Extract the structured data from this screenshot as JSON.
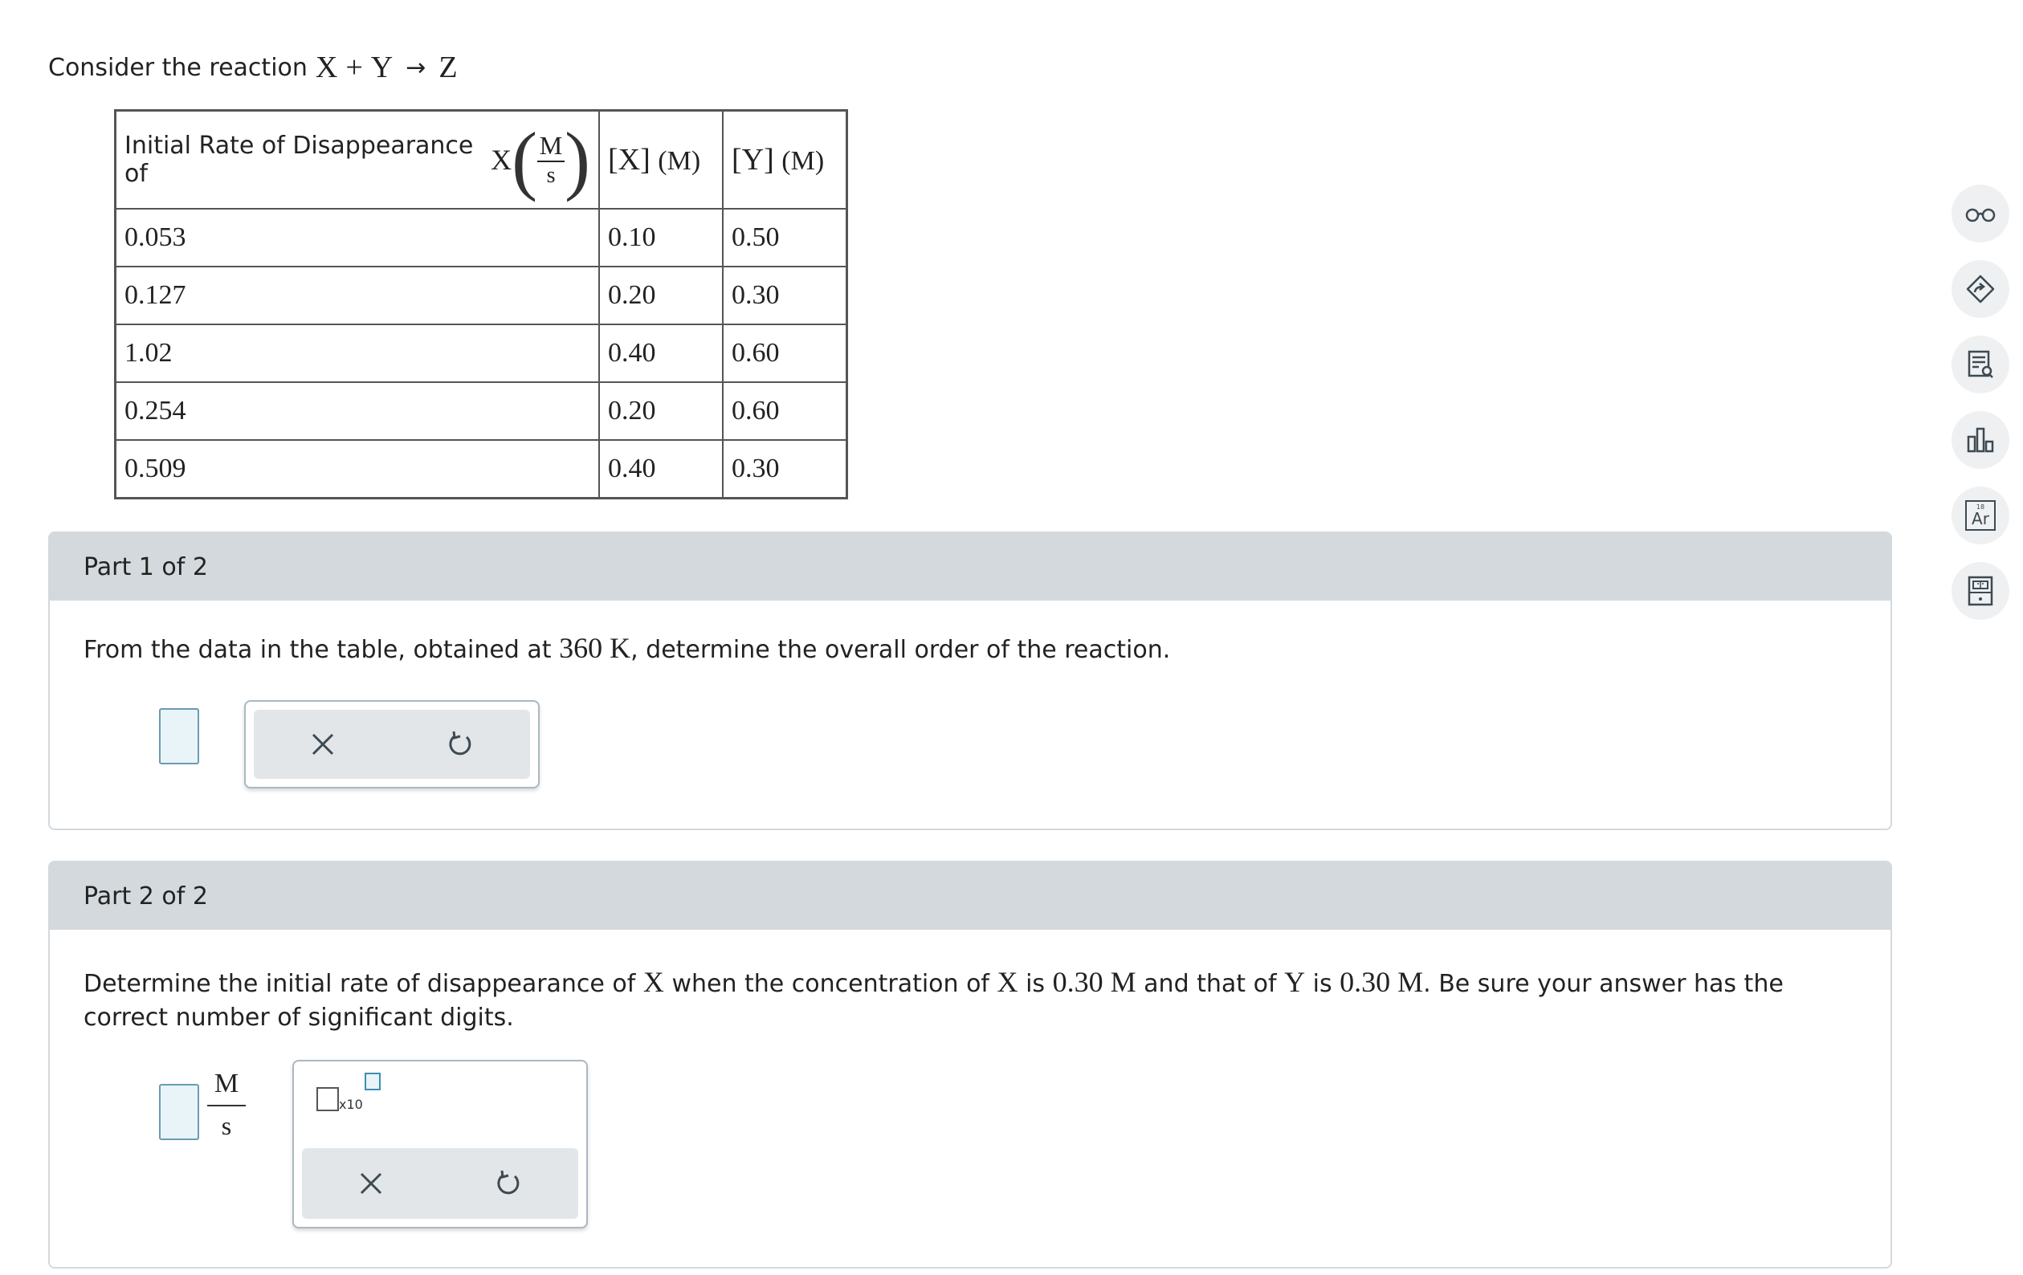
{
  "intro": {
    "prefix": "Consider the reaction",
    "reactant1": "X",
    "plus": "+",
    "reactant2": "Y",
    "arrow": "→",
    "product": "Z"
  },
  "table": {
    "header": {
      "rate_label": "Initial Rate of Disappearance of",
      "rate_species": "X",
      "rate_unit_num": "M",
      "rate_unit_den": "s",
      "x_col": "[X]",
      "x_unit": "(M)",
      "y_col": "[Y]",
      "y_unit": "(M)"
    },
    "rows": [
      {
        "rate": "0.053",
        "x": "0.10",
        "y": "0.50"
      },
      {
        "rate": "0.127",
        "x": "0.20",
        "y": "0.30"
      },
      {
        "rate": "1.02",
        "x": "0.40",
        "y": "0.60"
      },
      {
        "rate": "0.254",
        "x": "0.20",
        "y": "0.60"
      },
      {
        "rate": "0.509",
        "x": "0.40",
        "y": "0.30"
      }
    ]
  },
  "part1": {
    "title": "Part 1 of 2",
    "q_a": "From the data in the table, obtained at",
    "q_temp": "360 K",
    "q_b": ", determine the overall order of the reaction."
  },
  "part2": {
    "title": "Part 2 of 2",
    "q_a": "Determine the initial rate of disappearance of",
    "q_x1": "X",
    "q_b": "when the concentration of",
    "q_x2": "X",
    "q_c": "is",
    "q_cx": "0.30 M",
    "q_d": "and that of",
    "q_y": "Y",
    "q_e": "is",
    "q_cy": "0.30 M",
    "q_f": ". Be sure your answer has the correct number of significant digits.",
    "unit_num": "M",
    "unit_den": "s",
    "sci_label": "x10"
  },
  "colors": {
    "part_header": "#d3d9dd",
    "answer_fill": "#e8f4f8",
    "answer_border": "#6a9bb1",
    "toolbar_bg": "#e2e6e9"
  },
  "sidebar": {
    "icons": [
      "glasses-icon",
      "tag-arrow-icon",
      "notes-icon",
      "bar-chart-icon",
      "periodic-table-icon",
      "calculator-icon"
    ],
    "periodic_number": "18",
    "periodic_symbol": "Ar"
  }
}
